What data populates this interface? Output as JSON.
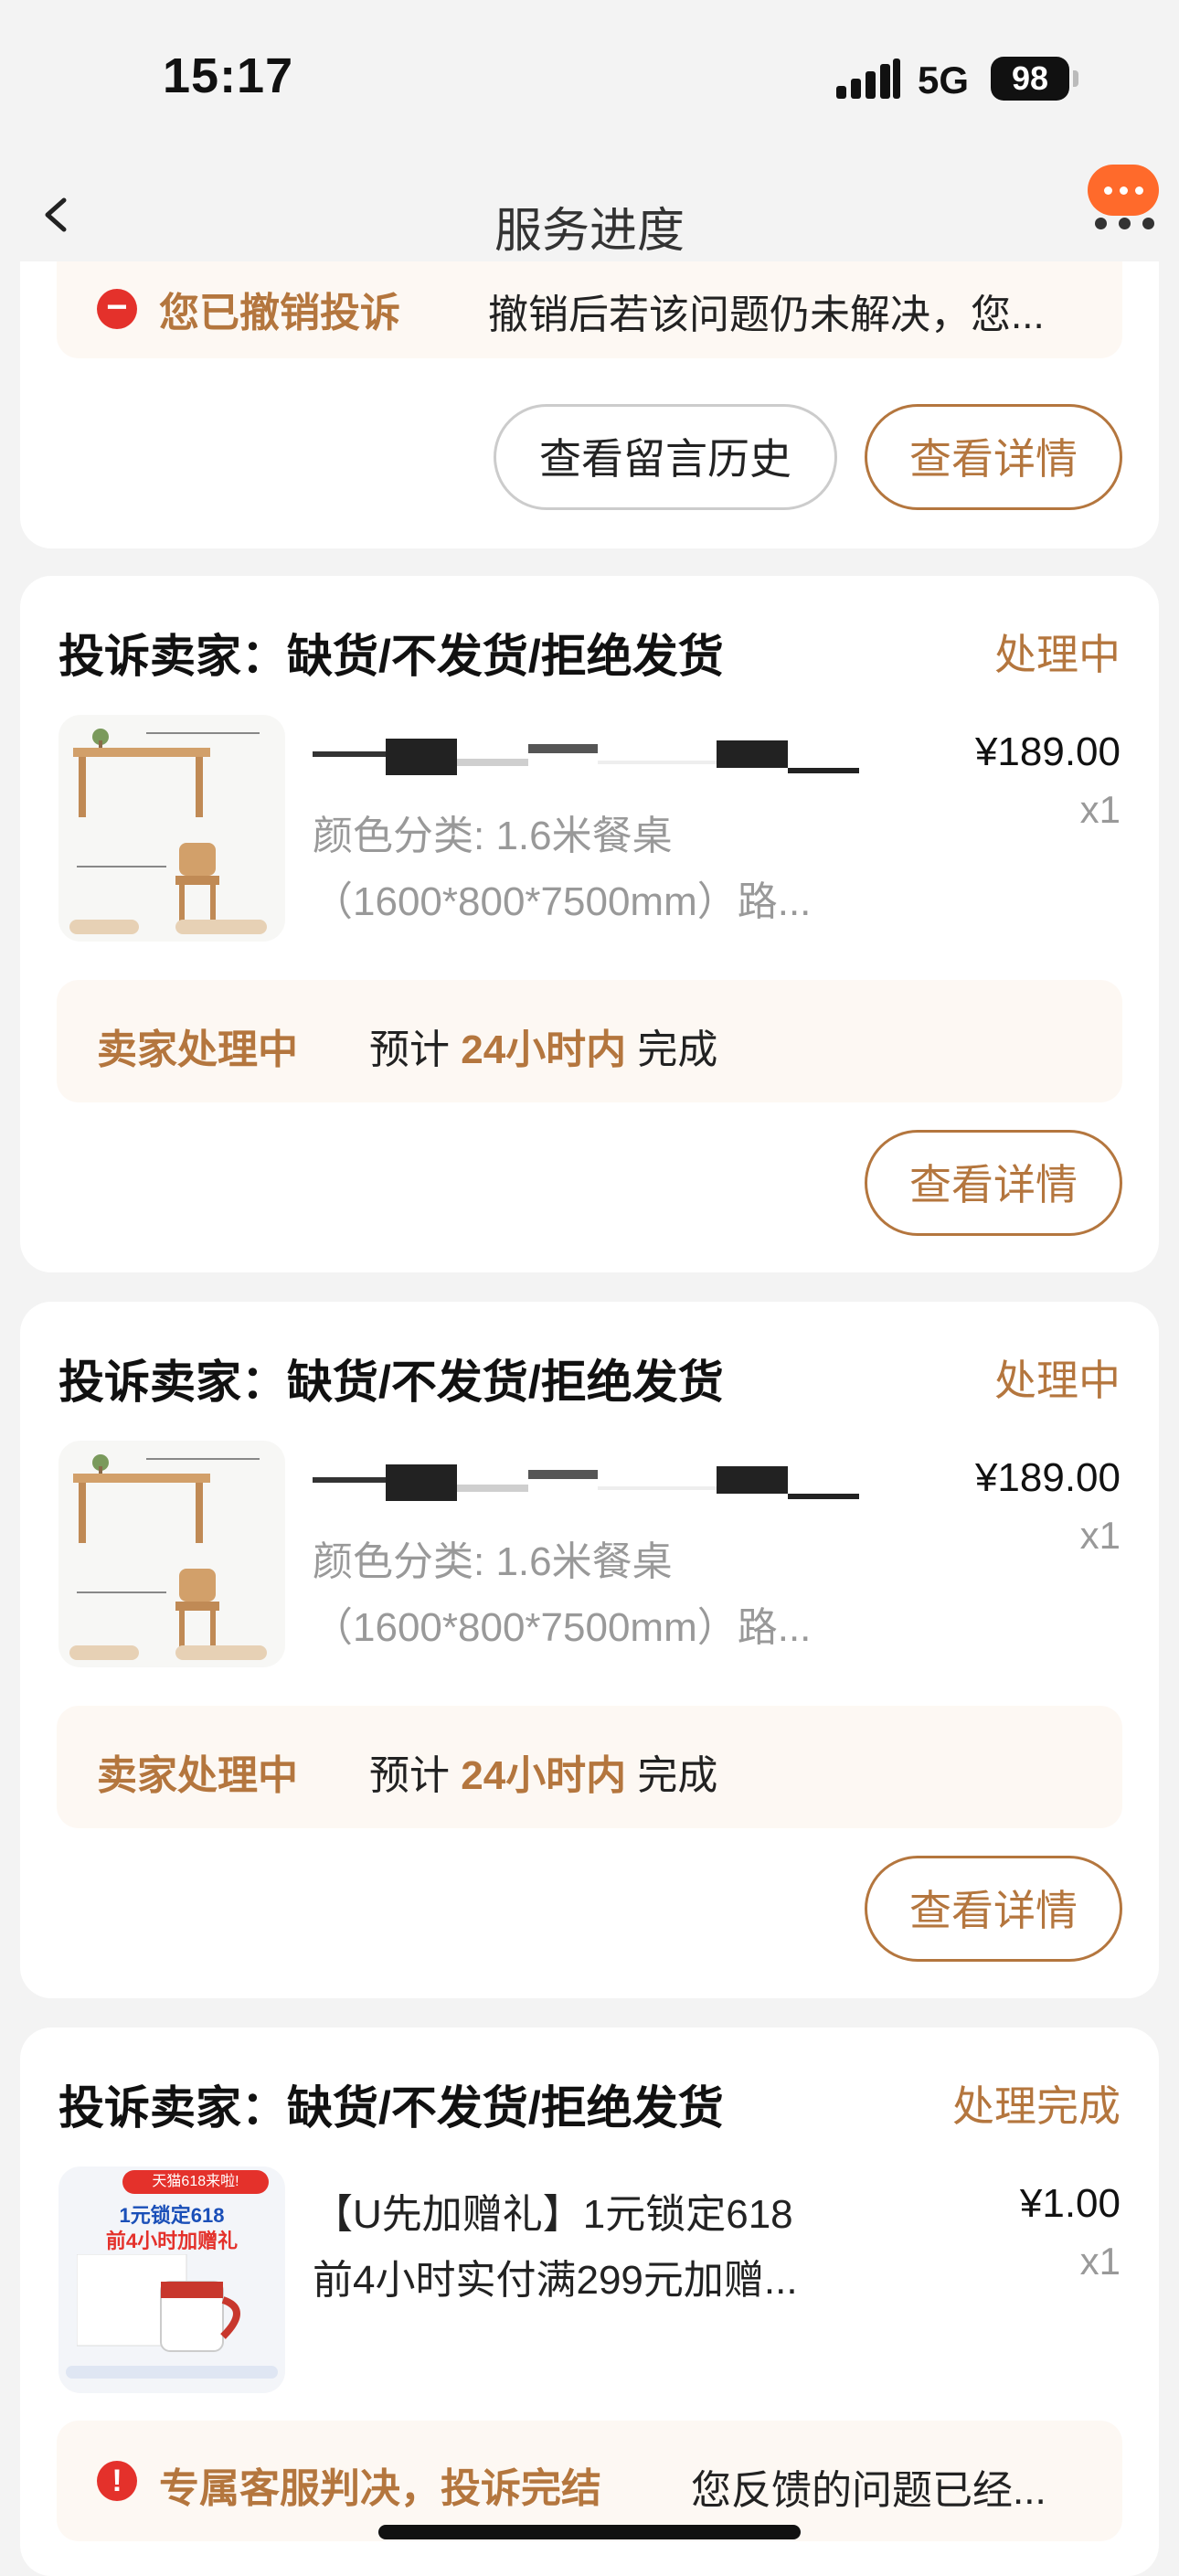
{
  "status_bar": {
    "time": "15:17",
    "network": "5G",
    "battery": "98"
  },
  "nav": {
    "title": "服务进度"
  },
  "card0": {
    "notice_title": "您已撤销投诉",
    "notice_text": "撤销后若该问题仍未解决，您...",
    "btn_history": "查看留言历史",
    "btn_detail": "查看详情"
  },
  "card1": {
    "title": "投诉卖家：缺货/不发货/拒绝发货",
    "status": "处理中",
    "spec_line1": "颜色分类: 1.6米餐桌",
    "spec_line2": "（1600*800*7500mm）路...",
    "price": "¥189.00",
    "qty": "x1",
    "progress_state": "卖家处理中",
    "progress_prefix": "预计",
    "progress_highlight": "24小时内",
    "progress_suffix": "完成",
    "btn_detail": "查看详情"
  },
  "card2": {
    "title": "投诉卖家：缺货/不发货/拒绝发货",
    "status": "处理中",
    "spec_line1": "颜色分类: 1.6米餐桌",
    "spec_line2": "（1600*800*7500mm）路...",
    "price": "¥189.00",
    "qty": "x1",
    "progress_state": "卖家处理中",
    "progress_prefix": "预计",
    "progress_highlight": "24小时内",
    "progress_suffix": "完成",
    "btn_detail": "查看详情"
  },
  "card3": {
    "title": "投诉卖家：缺货/不发货/拒绝发货",
    "status": "处理完成",
    "product_line1": "【U先加赠礼】1元锁定618",
    "product_line2": "前4小时实付满299元加赠...",
    "price": "¥1.00",
    "qty": "x1",
    "thumb_badge": "天猫618来啦!",
    "thumb_line1": "1元锁定618",
    "thumb_line2": "前4小时加赠礼",
    "notice_title": "专属客服判决，投诉完结",
    "notice_text": "您反馈的问题已经..."
  },
  "colors": {
    "accent": "#b4763e",
    "notice_bg": "#fdf8f3",
    "alert_red": "#e4312b",
    "brand_orange": "#ff6a2b"
  },
  "icons": [
    "back-chevron-icon",
    "more-options-icon",
    "minus-circle-icon",
    "exclamation-circle-icon"
  ]
}
